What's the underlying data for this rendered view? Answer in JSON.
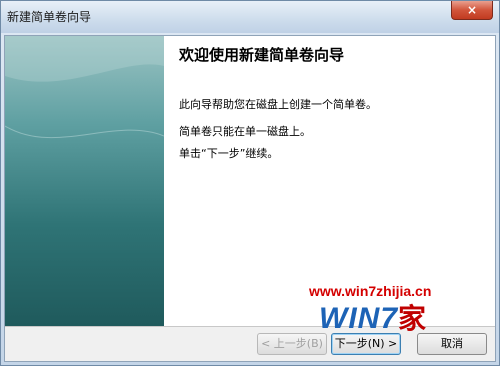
{
  "window": {
    "title": "新建简单卷向导",
    "close_symbol": "×"
  },
  "wizard": {
    "heading": "欢迎使用新建简单卷向导",
    "paragraphs": [
      "此向导帮助您在磁盘上创建一个简单卷。",
      "简单卷只能在单一磁盘上。",
      "单击“下一步”继续。"
    ]
  },
  "buttons": {
    "back": "< 上一步(B)",
    "next": "下一步(N) >",
    "cancel": "取消"
  },
  "watermark": {
    "url": "www.win7zhijia.cn",
    "logo": "WIN7",
    "logo_suffix": "家"
  },
  "colors": {
    "side_panel_top": "#9cc4c4",
    "side_panel_bottom": "#1f5a5c",
    "close_button": "#c13a20",
    "watermark_red": "#d40000",
    "watermark_blue": "#1d63b6"
  }
}
